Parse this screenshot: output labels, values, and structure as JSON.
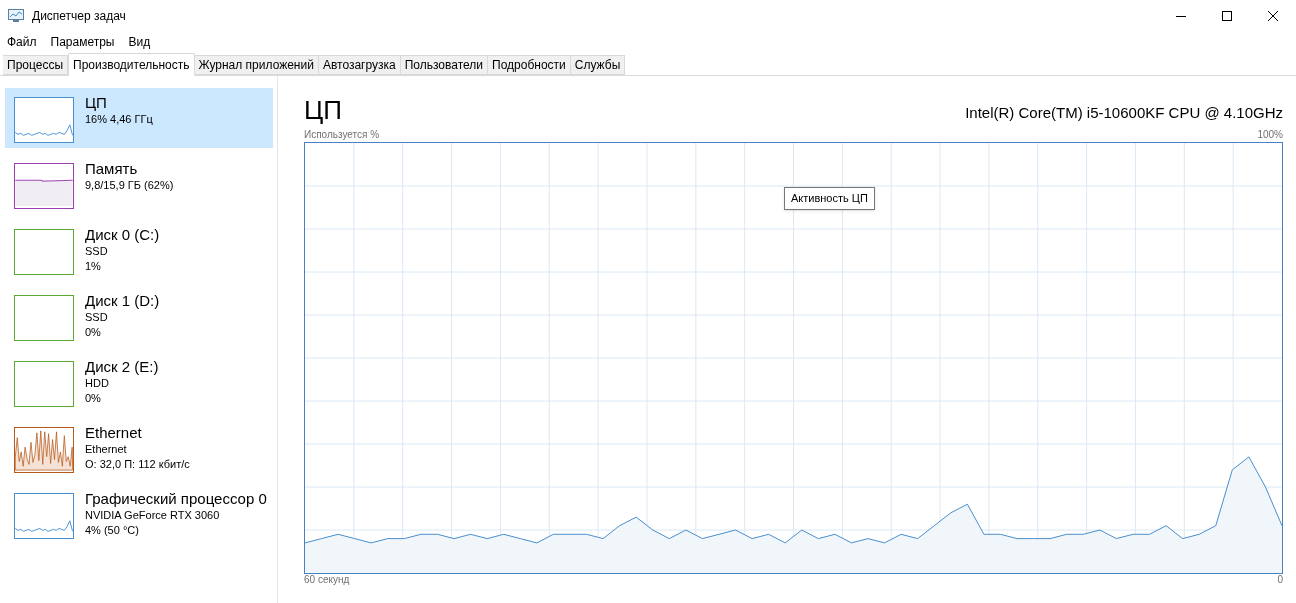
{
  "window": {
    "title": "Диспетчер задач"
  },
  "menu": [
    "Файл",
    "Параметры",
    "Вид"
  ],
  "tabs": [
    {
      "label": "Процессы",
      "selected": false
    },
    {
      "label": "Производительность",
      "selected": true
    },
    {
      "label": "Журнал приложений",
      "selected": false
    },
    {
      "label": "Автозагрузка",
      "selected": false
    },
    {
      "label": "Пользователи",
      "selected": false
    },
    {
      "label": "Подробности",
      "selected": false
    },
    {
      "label": "Службы",
      "selected": false
    }
  ],
  "sidebar": {
    "items": [
      {
        "title": "ЦП",
        "lines": [
          "16% 4,46 ГГц"
        ],
        "color": "#4a8fd0",
        "kind": "line",
        "selected": true
      },
      {
        "title": "Память",
        "lines": [
          "9,8/15,9 ГБ (62%)"
        ],
        "color": "#9b3fb0",
        "kind": "fill",
        "selected": false
      },
      {
        "title": "Диск 0 (C:)",
        "lines": [
          "SSD",
          "1%"
        ],
        "color": "#5aa832",
        "kind": "empty",
        "selected": false
      },
      {
        "title": "Диск 1 (D:)",
        "lines": [
          "SSD",
          "0%"
        ],
        "color": "#5aa832",
        "kind": "empty",
        "selected": false
      },
      {
        "title": "Диск 2 (E:)",
        "lines": [
          "HDD",
          "0%"
        ],
        "color": "#5aa832",
        "kind": "empty",
        "selected": false
      },
      {
        "title": "Ethernet",
        "lines": [
          "Ethernet",
          "О: 32,0 П: 112 кбит/с"
        ],
        "color": "#b85a1c",
        "kind": "spikes",
        "selected": false
      },
      {
        "title": "Графический процессор 0",
        "lines": [
          "NVIDIA GeForce RTX 3060",
          "4% (50 °C)"
        ],
        "color": "#4a8fd0",
        "kind": "line",
        "selected": false
      }
    ]
  },
  "main": {
    "title": "ЦП",
    "processor": "Intel(R) Core(TM) i5-10600KF CPU @ 4.10GHz",
    "ylabel": "Используется %",
    "ymax": "100%",
    "xstart": "60 секунд",
    "xend": "0",
    "tooltip": "Активность ЦП"
  }
}
